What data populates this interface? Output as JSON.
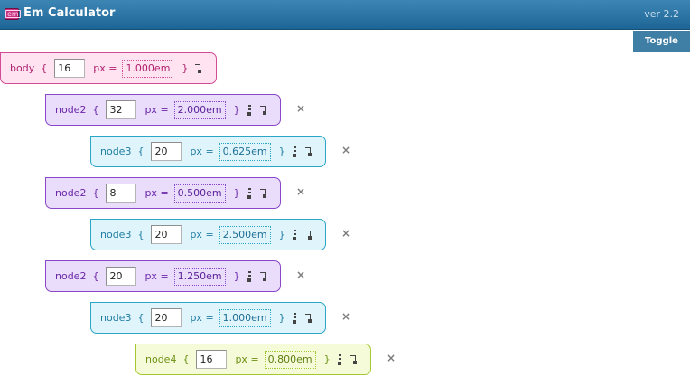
{
  "app": {
    "title": "Em Calculator",
    "version": "ver 2.2",
    "logo_text": "em"
  },
  "toolbar": {
    "toggle_label": "Toggle"
  },
  "labels": {
    "open_brace": "{",
    "close_brace": "}",
    "px_equals": "px =",
    "delete": "×"
  },
  "rows": [
    {
      "name": "body",
      "px": "16",
      "em": "1.000em"
    },
    {
      "name": "node2",
      "px": "32",
      "em": "2.000em"
    },
    {
      "name": "node3",
      "px": "20",
      "em": "0.625em"
    },
    {
      "name": "node2",
      "px": "8",
      "em": "0.500em"
    },
    {
      "name": "node3",
      "px": "20",
      "em": "2.500em"
    },
    {
      "name": "node2",
      "px": "20",
      "em": "1.250em"
    },
    {
      "name": "node3",
      "px": "20",
      "em": "1.000em"
    },
    {
      "name": "node4",
      "px": "16",
      "em": "0.800em"
    }
  ],
  "colors": {
    "titlebar": "#2a74a4",
    "body_level": "#d34b94",
    "node2_level": "#8a47c7",
    "node3_level": "#2aa6c9",
    "node4_level": "#a4c832"
  },
  "icons": {
    "add_child": "add-child-icon",
    "nest": "nest-icon",
    "delete": "delete-icon"
  }
}
